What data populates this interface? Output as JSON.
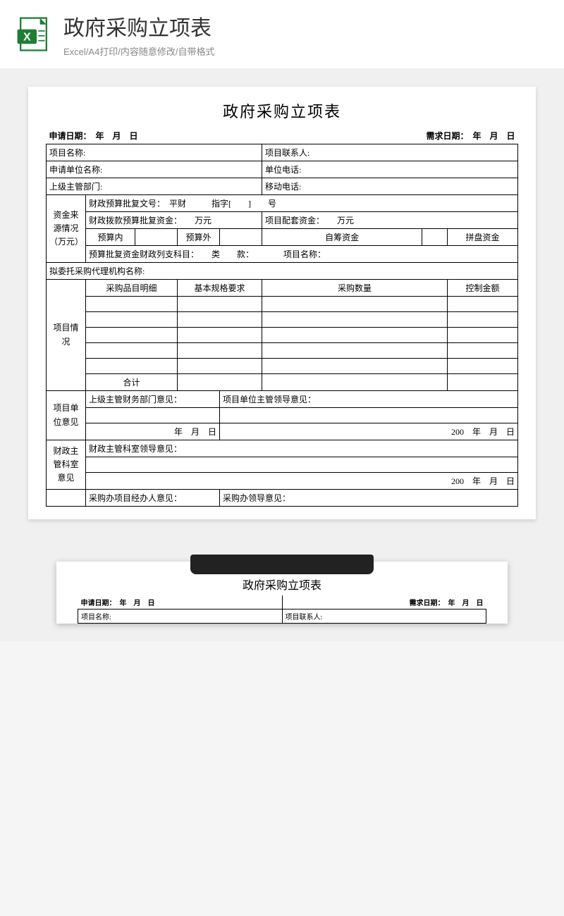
{
  "header": {
    "title": "政府采购立项表",
    "subtitle": "Excel/A4打印/内容随意修改/自带格式"
  },
  "form": {
    "title": "政府采购立项表",
    "apply_date_label": "申请日期：　年　月　日",
    "demand_date_label": "需求日期：　年　月　日",
    "project_name_label": "项目名称:",
    "project_contact_label": "项目联系人:",
    "apply_unit_label": "申请单位名称:",
    "unit_phone_label": "单位电话:",
    "supervisor_dept_label": "上级主管部门:",
    "mobile_phone_label": "移动电话:",
    "fund_source_label": "资金来源情况（万元）",
    "fiscal_doc_label": "财政预算批复文号：　平财　　　指字[　　]　　号",
    "fiscal_fund_label": "财政拨款预算批复资金：　　万元",
    "matching_fund_label": "项目配套资金：　　万元",
    "budget_in_label": "预算内",
    "budget_out_label": "预算外",
    "self_fund_label": "自筹资金",
    "pool_fund_label": "拼盘资金",
    "subject_label": "预算批复资金财政列支科目：　　类　　款：　　　　项目名称：",
    "agency_label": "拟委托采购代理机构名称:",
    "item_section_label": "项目情况",
    "col_item": "采购品目明细",
    "col_spec": "基本规格要求",
    "col_qty": "采购数量",
    "col_amount": "控制金额",
    "total_label": "合计",
    "unit_opinion_label": "项目单位意见",
    "supervisor_finance_label": "上级主管财务部门意见：",
    "unit_leader_label": "项目单位主管领导意见：",
    "date_ymd": "年　月　日",
    "date_200": "200　年　月　日",
    "fiscal_office_label": "财政主管科室意见",
    "fiscal_leader_label": "财政主管科室领导意见：",
    "procure_handler_label": "采购办项目经办人意见：",
    "procure_leader_label": "采购办领导意见："
  }
}
